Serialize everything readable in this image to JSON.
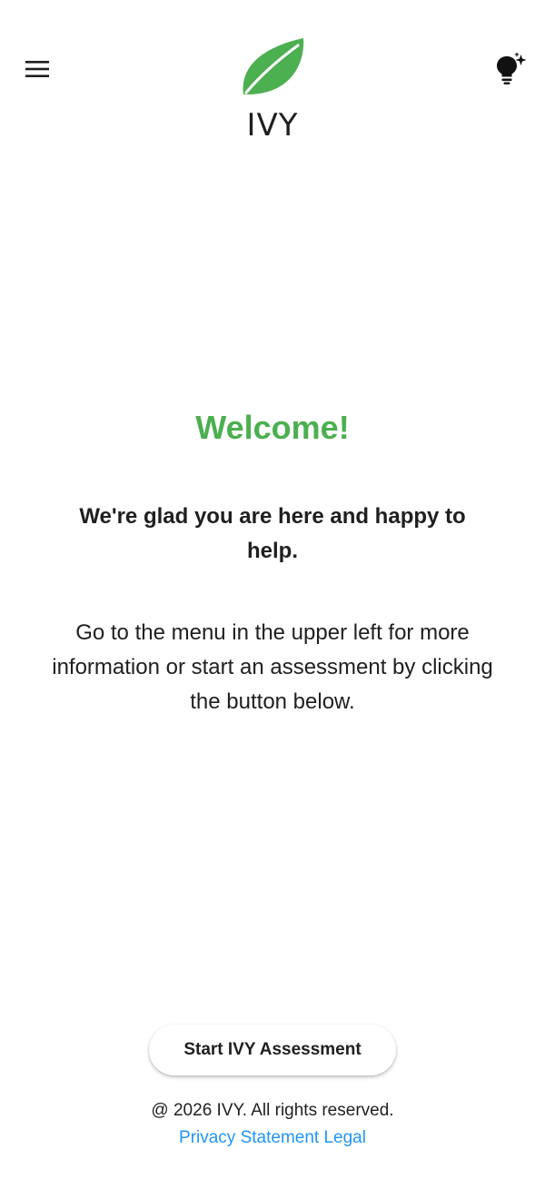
{
  "header": {
    "app_name": "IVY",
    "menu_icon": "hamburger-menu-icon",
    "tip_icon": "lightbulb-sparkle-icon",
    "logo_icon": "leaf-logo-icon"
  },
  "main": {
    "heading": "Welcome!",
    "subtitle": "We're glad you are here and happy to help.",
    "body": "Go to the menu in the upper left for more information or start an assessment by clicking the button below."
  },
  "actions": {
    "start_label": "Start IVY Assessment"
  },
  "footer": {
    "copyright": "@ 2026 IVY. All rights reserved.",
    "privacy_label": "Privacy Statement",
    "legal_label": "Legal"
  },
  "colors": {
    "brand_green": "#4caf50",
    "link_blue": "#2196f3",
    "text_dark": "#1f1f1f",
    "background": "#ffffff"
  }
}
